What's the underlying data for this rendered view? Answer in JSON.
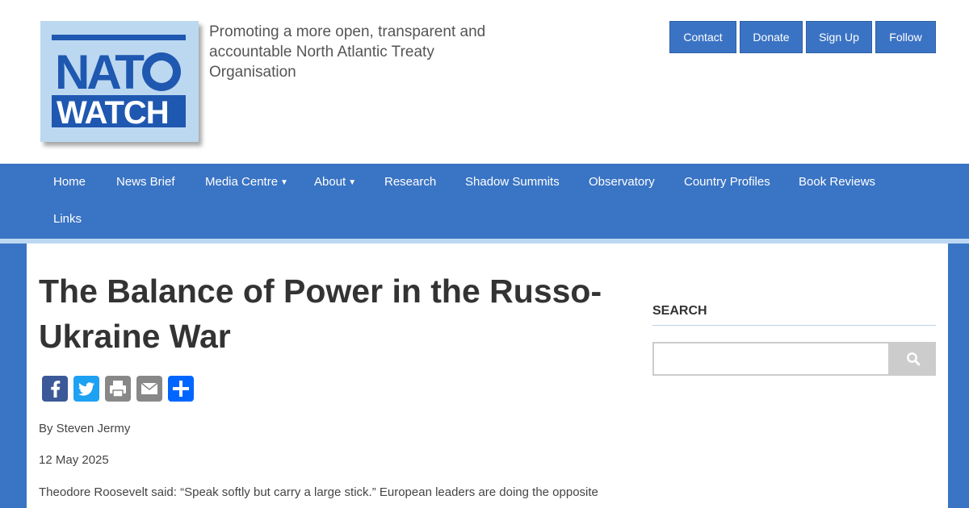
{
  "site": {
    "logo_alt": "NATO WATCH",
    "tagline": "Promoting a more open, transparent and accountable North Atlantic Treaty Organisation"
  },
  "top_buttons": [
    {
      "label": "Contact"
    },
    {
      "label": "Donate"
    },
    {
      "label": "Sign Up"
    },
    {
      "label": "Follow"
    }
  ],
  "nav": {
    "items": [
      {
        "label": "Home"
      },
      {
        "label": "News Brief"
      },
      {
        "label": "Media Centre",
        "caret": "▼"
      },
      {
        "label": "About",
        "caret": "▼"
      },
      {
        "label": "Research"
      },
      {
        "label": "Shadow Summits"
      },
      {
        "label": "Observatory"
      },
      {
        "label": "Country Profiles"
      },
      {
        "label": "Book Reviews"
      },
      {
        "label": "Links"
      }
    ]
  },
  "article": {
    "title": "The Balance of Power in the Russo-Ukraine War",
    "byline": "By Steven Jermy",
    "date": "12 May 2025",
    "body": "Theodore Roosevelt said: “Speak softly but carry a large stick.” European leaders are doing the opposite"
  },
  "share": [
    {
      "icon": "facebook-icon",
      "color": "#3b5998"
    },
    {
      "icon": "twitter-icon",
      "color": "#1da1f2"
    },
    {
      "icon": "print-icon",
      "color": "#888888"
    },
    {
      "icon": "email-icon",
      "color": "#888888"
    },
    {
      "icon": "share-icon",
      "color": "#0166ff"
    }
  ],
  "sidebar": {
    "search_heading": "SEARCH",
    "search_placeholder": "",
    "search_icon": "search-icon"
  },
  "colors": {
    "brand_blue": "#3a74c4",
    "light_blue": "#bcd8f0",
    "button_blue": "#3b73c4"
  }
}
